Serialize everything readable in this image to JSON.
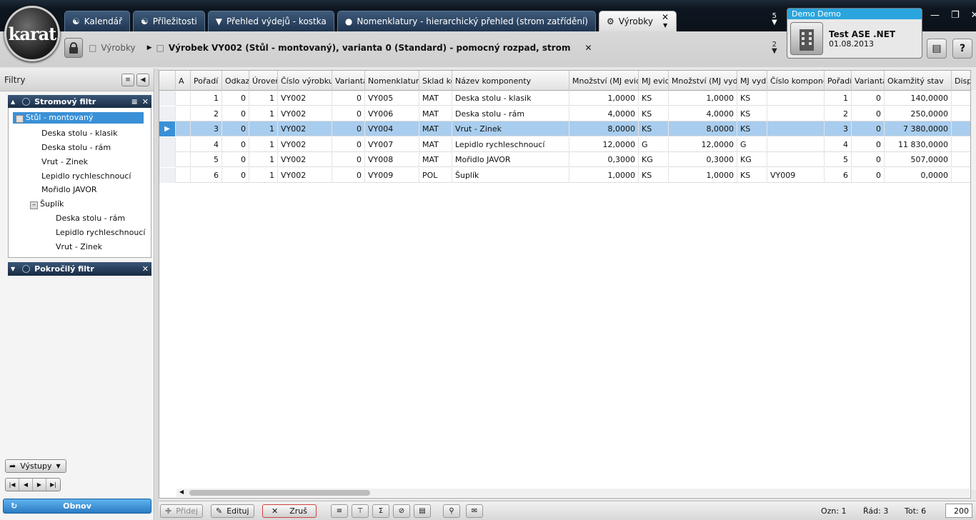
{
  "logo_text": "karat",
  "tabs": [
    {
      "label": "Kalendář",
      "icon": "handshake-icon"
    },
    {
      "label": "Příležitosti",
      "icon": "handshake-icon"
    },
    {
      "label": "Přehled výdejů - kostka",
      "icon": "tie-icon"
    },
    {
      "label": "Nomenklatury - hierarchický přehled (strom zatřídění)",
      "icon": "coins-icon"
    },
    {
      "label": "Výrobky",
      "icon": "gears-icon",
      "active": true
    }
  ],
  "tab_overflow_count": "5",
  "breadcrumb": {
    "first": "Výrobky",
    "second": "Výrobek VY002 (Stůl - montovaný), varianta 0 (Standard) - pomocný rozpad, strom"
  },
  "breadcrumb_overflow_count": "2",
  "user": {
    "header": "Demo Demo",
    "company": "Test ASE .NET",
    "date": "01.08.2013"
  },
  "left_panel": {
    "title": "Filtry",
    "tree_filter": {
      "title": "Stromový filtr",
      "root": "Stůl - montovaný",
      "children": [
        "Deska stolu - klasik",
        "Deska stolu - rám",
        "Vrut - Zinek",
        "Lepidlo rychleschnoucí",
        "Mořidlo JAVOR"
      ],
      "sub_parent": "Šuplík",
      "sub_children": [
        "Deska stolu - rám",
        "Lepidlo rychleschnoucí",
        "Vrut - Zinek"
      ]
    },
    "advanced_filter": {
      "title": "Pokročilý filtr"
    },
    "outputs_label": "Výstupy",
    "refresh_label": "Obnov"
  },
  "grid": {
    "columns": [
      "A",
      "Pořadí",
      "Odkaz",
      "Úroveň",
      "Číslo výrobku",
      "Varianta",
      "Nomenklatura",
      "Sklad ko",
      "Název komponenty",
      "Množství (MJ evid",
      "MJ evid",
      "Množství (MJ vyd.)",
      "MJ vyd.",
      "Číslo kompone",
      "Pořadí",
      "Varianta",
      "Okamžitý stav",
      "Dispo"
    ],
    "rows": [
      [
        "",
        "1",
        "0",
        "1",
        "VY002",
        "0",
        "VY005",
        "MAT",
        "Deska stolu - klasik",
        "1,0000",
        "KS",
        "1,0000",
        "KS",
        "",
        "1",
        "0",
        "140,0000",
        ""
      ],
      [
        "",
        "2",
        "0",
        "1",
        "VY002",
        "0",
        "VY006",
        "MAT",
        "Deska stolu - rám",
        "4,0000",
        "KS",
        "4,0000",
        "KS",
        "",
        "2",
        "0",
        "250,0000",
        ""
      ],
      [
        "",
        "3",
        "0",
        "1",
        "VY002",
        "0",
        "VY004",
        "MAT",
        "Vrut - Zinek",
        "8,0000",
        "KS",
        "8,0000",
        "KS",
        "",
        "3",
        "0",
        "7 380,0000",
        ""
      ],
      [
        "",
        "4",
        "0",
        "1",
        "VY002",
        "0",
        "VY007",
        "MAT",
        "Lepidlo rychleschnoucí",
        "12,0000",
        "G",
        "12,0000",
        "G",
        "",
        "4",
        "0",
        "11 830,0000",
        ""
      ],
      [
        "",
        "5",
        "0",
        "1",
        "VY002",
        "0",
        "VY008",
        "MAT",
        "Mořidlo JAVOR",
        "0,3000",
        "KG",
        "0,3000",
        "KG",
        "",
        "5",
        "0",
        "507,0000",
        ""
      ],
      [
        "",
        "6",
        "0",
        "1",
        "VY002",
        "0",
        "VY009",
        "POL",
        "Šuplík",
        "1,0000",
        "KS",
        "1,0000",
        "KS",
        "VY009",
        "6",
        "0",
        "0,0000",
        ""
      ]
    ],
    "selected_row": 2
  },
  "bottom": {
    "add_label": "Přidej",
    "edit_label": "Edituj",
    "cancel_label": "Zruš",
    "marked": "Ozn: 1",
    "row": "Řád: 3",
    "total": "Tot: 6",
    "page_size": "200"
  }
}
